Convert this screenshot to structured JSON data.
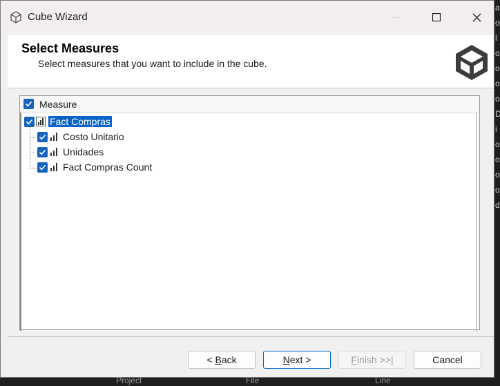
{
  "window": {
    "title": "Cube Wizard",
    "controls": [
      "minimize",
      "maximize",
      "close"
    ]
  },
  "header": {
    "title": "Select Measures",
    "subtitle": "Select measures that you want to include in the cube."
  },
  "tree": {
    "column_header": "Measure",
    "header_checked": true,
    "root": {
      "label": "Fact Compras",
      "checked": true,
      "selected": true,
      "icon": "measure-group-icon",
      "children": [
        {
          "label": "Costo Unitario",
          "checked": true,
          "icon": "measure-icon"
        },
        {
          "label": "Unidades",
          "checked": true,
          "icon": "measure-icon"
        },
        {
          "label": "Fact Compras Count",
          "checked": true,
          "icon": "measure-icon"
        }
      ]
    }
  },
  "buttons": {
    "back": {
      "prefix": "< ",
      "mnemonic": "B",
      "rest": "ack",
      "enabled": true
    },
    "next": {
      "mnemonic": "N",
      "rest": "ext >",
      "enabled": true,
      "default": true
    },
    "finish": {
      "mnemonic": "F",
      "rest": "inish >>|",
      "enabled": false
    },
    "cancel": {
      "label": "Cancel",
      "enabled": true
    }
  },
  "background": {
    "right_chars": [
      "a",
      "o",
      "l",
      "o",
      "o",
      "o",
      "o",
      "D",
      "i",
      "o",
      "o",
      "o",
      "o",
      "d"
    ],
    "bottom_labels": [
      "Project",
      "File",
      "Line"
    ]
  },
  "colors": {
    "accent": "#0a64c8",
    "checkbox": "#1565c0",
    "titlebar": "#f3eeee",
    "dialog": "#f0f0f0"
  }
}
